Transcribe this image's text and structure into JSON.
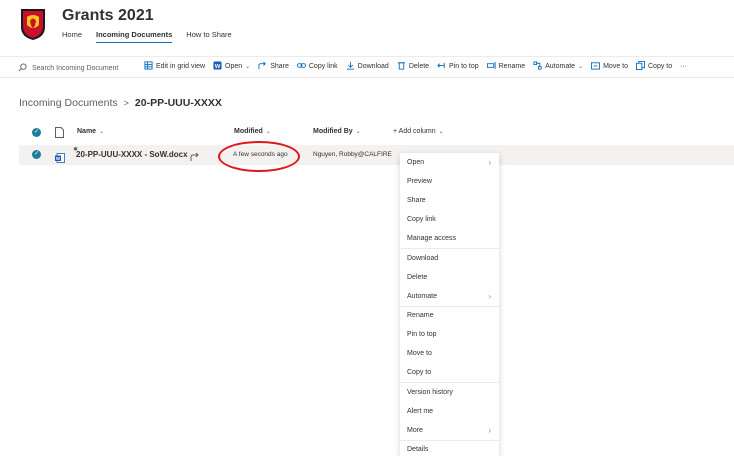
{
  "site": {
    "title": "Grants 2021",
    "nav": [
      "Home",
      "Incoming Documents",
      "How to Share"
    ]
  },
  "command_bar": {
    "search_placeholder": "Search Incoming Document",
    "commands": [
      {
        "label": "Edit in grid view",
        "icon": "grid-icon"
      },
      {
        "label": "Open",
        "icon": "word-icon",
        "has_dropdown": true
      },
      {
        "label": "Share",
        "icon": "share-icon"
      },
      {
        "label": "Copy link",
        "icon": "link-icon"
      },
      {
        "label": "Download",
        "icon": "download-icon"
      },
      {
        "label": "Delete",
        "icon": "trash-icon"
      },
      {
        "label": "Pin to top",
        "icon": "pin-icon"
      },
      {
        "label": "Rename",
        "icon": "rename-icon"
      },
      {
        "label": "Automate",
        "icon": "automate-icon",
        "has_dropdown": true
      },
      {
        "label": "Move to",
        "icon": "move-icon"
      },
      {
        "label": "Copy to",
        "icon": "copy-icon"
      }
    ],
    "more": "···"
  },
  "breadcrumb": {
    "parent": "Incoming Documents",
    "separator": ">",
    "current": "20-PP-UUU-XXXX"
  },
  "list": {
    "columns": {
      "name": "Name",
      "modified": "Modified",
      "modified_by": "Modified By",
      "add_column": "+ Add column"
    },
    "rows": [
      {
        "name": "20-PP-UUU-XXXX - SoW.docx",
        "modified": "A few seconds ago",
        "modified_by": "Nguyen, Robby@CALFIRE"
      }
    ]
  },
  "context_menu": {
    "items": [
      {
        "label": "Open",
        "submenu": true
      },
      {
        "label": "Preview"
      },
      {
        "label": "Share"
      },
      {
        "label": "Copy link"
      },
      {
        "label": "Manage access"
      },
      {
        "label": "Download"
      },
      {
        "label": "Delete"
      },
      {
        "label": "Automate",
        "submenu": true
      },
      {
        "label": "Rename"
      },
      {
        "label": "Pin to top"
      },
      {
        "label": "Move to"
      },
      {
        "label": "Copy to"
      },
      {
        "label": "Version history"
      },
      {
        "label": "Alert me"
      },
      {
        "label": "More",
        "submenu": true
      },
      {
        "label": "Details"
      }
    ]
  },
  "colors": {
    "accent": "#0f6cbd",
    "check": "#1e7b9c",
    "highlight": "#e0161b"
  }
}
